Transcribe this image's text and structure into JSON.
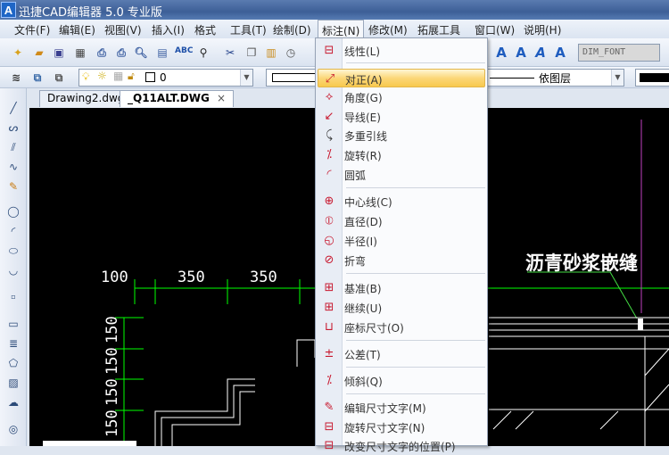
{
  "window": {
    "title": "迅捷CAD编辑器 5.0 专业版",
    "logo": "A"
  },
  "menubar": [
    "文件(F)",
    "编辑(E)",
    "视图(V)",
    "插入(I)",
    "格式",
    "工具(T)",
    "绘制(D)",
    "标注(N)",
    "修改(M)",
    "拓展工具",
    "窗口(W)",
    "说明(H)"
  ],
  "toolbar": {
    "font_combo": "DIM_FONT",
    "layer_combo": "0",
    "linetype_combo": "依图层"
  },
  "tabs": [
    {
      "label": "Drawing2.dwg"
    },
    {
      "label": "_Q11ALT.DWG",
      "close": "×"
    }
  ],
  "menu": {
    "items": [
      {
        "label": "线性(L)",
        "icon": "linear-dim-icon"
      },
      {
        "label": "对正(A)",
        "icon": "aligned-dim-icon",
        "highlighted": true
      },
      {
        "label": "角度(G)",
        "icon": "angular-dim-icon"
      },
      {
        "label": "导线(E)",
        "icon": "leader-icon"
      },
      {
        "label": "多重引线",
        "icon": "multileader-icon"
      },
      {
        "label": "旋转(R)",
        "icon": "rotated-dim-icon"
      },
      {
        "label": "圆弧",
        "icon": "arc-dim-icon"
      },
      {
        "label": "中心线(C)",
        "icon": "center-mark-icon"
      },
      {
        "label": "直径(D)",
        "icon": "diameter-icon"
      },
      {
        "label": "半径(I)",
        "icon": "radius-icon"
      },
      {
        "label": "折弯",
        "icon": "jogged-icon"
      },
      {
        "label": "基准(B)",
        "icon": "baseline-icon"
      },
      {
        "label": "继续(U)",
        "icon": "continue-icon"
      },
      {
        "label": "座标尺寸(O)",
        "icon": "ordinate-icon"
      },
      {
        "label": "公差(T)",
        "icon": "tolerance-icon"
      },
      {
        "label": "倾斜(Q)",
        "icon": "oblique-icon"
      },
      {
        "label": "编辑尺寸文字(M)",
        "icon": "edit-dim-text-icon"
      },
      {
        "label": "旋转尺寸文字(N)",
        "icon": "rotate-dim-text-icon"
      },
      {
        "label": "改变尺寸文字的位置(P)",
        "icon": "move-dim-text-icon"
      }
    ]
  },
  "drawing": {
    "h_dims": [
      "100",
      "350",
      "350"
    ],
    "v_dims": [
      "150",
      "150",
      "150",
      "150"
    ],
    "annotation": "沥青砂浆嵌缝"
  },
  "colors": {
    "canvas": "#000000",
    "dim": "#00ff00",
    "highlight": "#f8c94e",
    "magenta": "#c040c0"
  }
}
